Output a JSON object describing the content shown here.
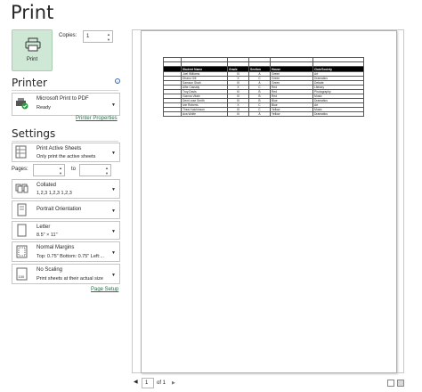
{
  "title": "Print",
  "print_button": {
    "label": "Print",
    "icon": "printer-icon"
  },
  "copies": {
    "label": "Copies:",
    "value": "1"
  },
  "printer": {
    "section": "Printer",
    "name": "Microsoft Print to PDF",
    "status": "Ready",
    "properties_link": "Printer Properties",
    "info_icon": "i"
  },
  "settings": {
    "section": "Settings",
    "print_what": {
      "title": "Print Active Sheets",
      "subtitle": "Only print the active sheets"
    },
    "pages_label": "Pages:",
    "pages_from": "",
    "pages_to_label": "to",
    "pages_to": "",
    "collation": {
      "title": "Collated",
      "subtitle": "1,2,3    1,2,3    1,2,3"
    },
    "orientation": {
      "title": "Portrait Orientation"
    },
    "paper": {
      "title": "Letter",
      "subtitle": "8.5\" × 11\""
    },
    "margins": {
      "title": "Normal Margins",
      "subtitle": "Top: 0.75\" Bottom: 0.75\" Left:..."
    },
    "scaling": {
      "title": "No Scaling",
      "subtitle": "Print sheets at their actual size"
    },
    "page_setup_link": "Page Setup"
  },
  "preview": {
    "headers": [
      "",
      "Student Name",
      "Grade",
      "Section",
      "House",
      "Club/Society"
    ],
    "rows": [
      [
        "",
        "Joel Williams",
        "IX",
        "A",
        "Green",
        "Art"
      ],
      [
        "",
        "Dhanu Gill",
        "X",
        "C",
        "Green",
        "Dramatics"
      ],
      [
        "",
        "Samson Shah",
        "IX",
        "A",
        "Green",
        "Debate"
      ],
      [
        "",
        "Alfie Cassidy",
        "X",
        "C",
        "Red",
        "Literary"
      ],
      [
        "",
        "Troy Davis",
        "IX",
        "B",
        "Red",
        "Photography"
      ],
      [
        "",
        "Gianna Vitale",
        "IX",
        "B",
        "Red",
        "Music"
      ],
      [
        "",
        "Demi-rose Smith",
        "IX",
        "B",
        "Blue",
        "Dramatics"
      ],
      [
        "",
        "Ivie Roberts",
        "X",
        "C",
        "Blue",
        "Art"
      ],
      [
        "",
        "Thea Hutchinson",
        "IX",
        "C",
        "Yellow",
        "Music"
      ],
      [
        "",
        "Ava Wolfe",
        "IX",
        "A",
        "Yellow",
        "Dramatics"
      ]
    ]
  },
  "pager": {
    "current": "1",
    "of_label": "of 1"
  },
  "colors": {
    "print_button_bg": "#cfe8d6",
    "link": "#217346",
    "header_fill": "#000000"
  }
}
